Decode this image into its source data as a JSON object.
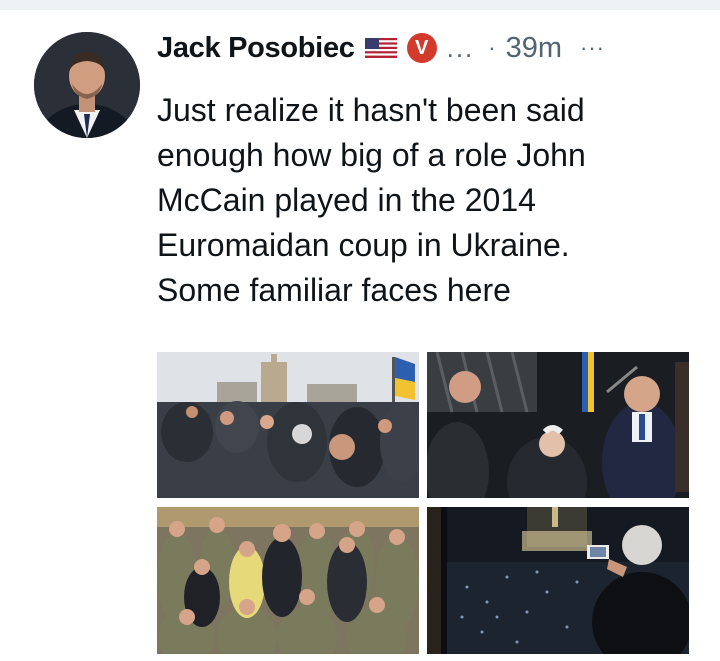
{
  "tweet": {
    "author": {
      "display_name": "Jack Posobiec",
      "flag_icon": "us-flag-icon",
      "badge_icon": "verified-v-badge-icon",
      "badge_letter": "V",
      "truncation": "...",
      "separator": "·",
      "timestamp": "39m",
      "more_label": "···"
    },
    "text_lines": [
      "Just realize it hasn't been said",
      "enough how big of a role John",
      "McCain played in the 2014",
      "Euromaidan coup in Ukraine.",
      "Some familiar faces here"
    ],
    "media": [
      {
        "name": "crowd-in-square-photo"
      },
      {
        "name": "stage-speakers-photo"
      },
      {
        "name": "group-with-soldiers-photo"
      },
      {
        "name": "night-square-from-window-photo"
      }
    ]
  },
  "colors": {
    "text": "#0f1419",
    "secondary": "#536471",
    "badge": "#d33a2c"
  }
}
